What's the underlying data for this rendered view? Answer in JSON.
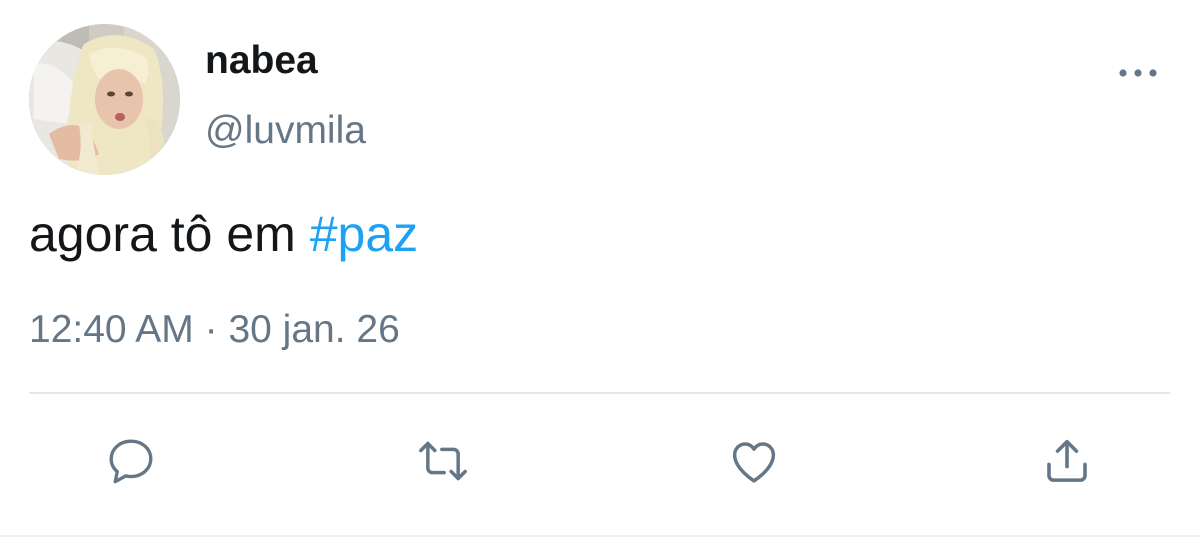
{
  "tweet": {
    "display_name": "nabea",
    "handle": "@luvmila",
    "text_plain": "agora tô em ",
    "hashtag": "#paz",
    "time": "12:40 AM",
    "separator": " · ",
    "date": "30 jan. 26"
  },
  "icons": {
    "more": "more-horizontal-icon",
    "reply": "reply-bubble-icon",
    "retweet": "retweet-icon",
    "like": "heart-icon",
    "share": "share-upload-icon"
  },
  "colors": {
    "text": "#14171a",
    "secondary": "#657786",
    "link": "#1da1f2",
    "divider": "#e1e8ed"
  }
}
